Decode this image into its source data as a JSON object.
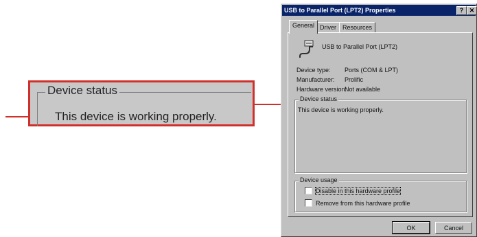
{
  "callout": {
    "legend": "Device status",
    "text": "This device is working properly."
  },
  "dialog": {
    "title": "USB to Parallel Port (LPT2) Properties",
    "help_label": "?",
    "close_label": "✕",
    "tabs": [
      {
        "label": "General",
        "active": true
      },
      {
        "label": "Driver",
        "active": false
      },
      {
        "label": "Resources",
        "active": false
      }
    ],
    "device_name": "USB to Parallel Port (LPT2)",
    "properties": {
      "device_type_label": "Device type:",
      "device_type_value": "Ports (COM & LPT)",
      "manufacturer_label": "Manufacturer:",
      "manufacturer_value": "Prolific",
      "hardware_version_label": "Hardware version:",
      "hardware_version_value": "Not available"
    },
    "device_status": {
      "legend": "Device status",
      "text": "This device is working properly."
    },
    "device_usage": {
      "legend": "Device usage",
      "disable_label": "Disable in this hardware profile",
      "remove_label": "Remove from this hardware profile"
    },
    "ok_label": "OK",
    "cancel_label": "Cancel"
  },
  "colors": {
    "annotation": "#d0302b",
    "title_bar": "#0a246a",
    "dialog_face": "#c0c0c0"
  },
  "icons": [
    "usb-parallel-cable-icon",
    "help-icon",
    "close-icon",
    "arrow-icon"
  ]
}
